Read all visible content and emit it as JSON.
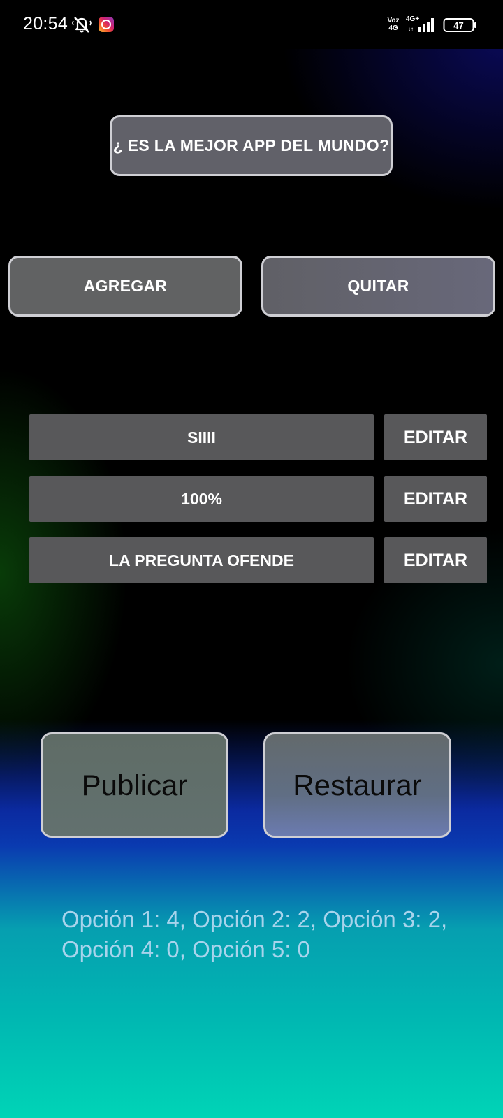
{
  "status_bar": {
    "time": "20:54",
    "volte_top": "Voz",
    "volte_bottom": "4G",
    "network_type": "4G+",
    "battery_level": "47",
    "icons": [
      "silent-bell-icon",
      "instagram-icon",
      "volte-icon",
      "signal-icon",
      "battery-icon"
    ]
  },
  "question": {
    "label": "¿ ES LA MEJOR APP DEL MUNDO?"
  },
  "actions": {
    "add_label": "AGREGAR",
    "remove_label": "QUITAR"
  },
  "options": [
    {
      "label": "SIIII",
      "edit_label": "EDITAR"
    },
    {
      "label": "100%",
      "edit_label": "EDITAR"
    },
    {
      "label": "LA PREGUNTA OFENDE",
      "edit_label": "EDITAR"
    }
  ],
  "bottom_actions": {
    "publish_label": "Publicar",
    "restore_label": "Restaurar"
  },
  "results": {
    "text": "Opción 1: 4, Opción 2: 2, Opción 3: 2, Opción 4: 0, Opción 5: 0"
  },
  "colors": {
    "button_outline": "#cfcfd4",
    "option_bg": "#58585a",
    "results_text": "#a8d4ec"
  }
}
